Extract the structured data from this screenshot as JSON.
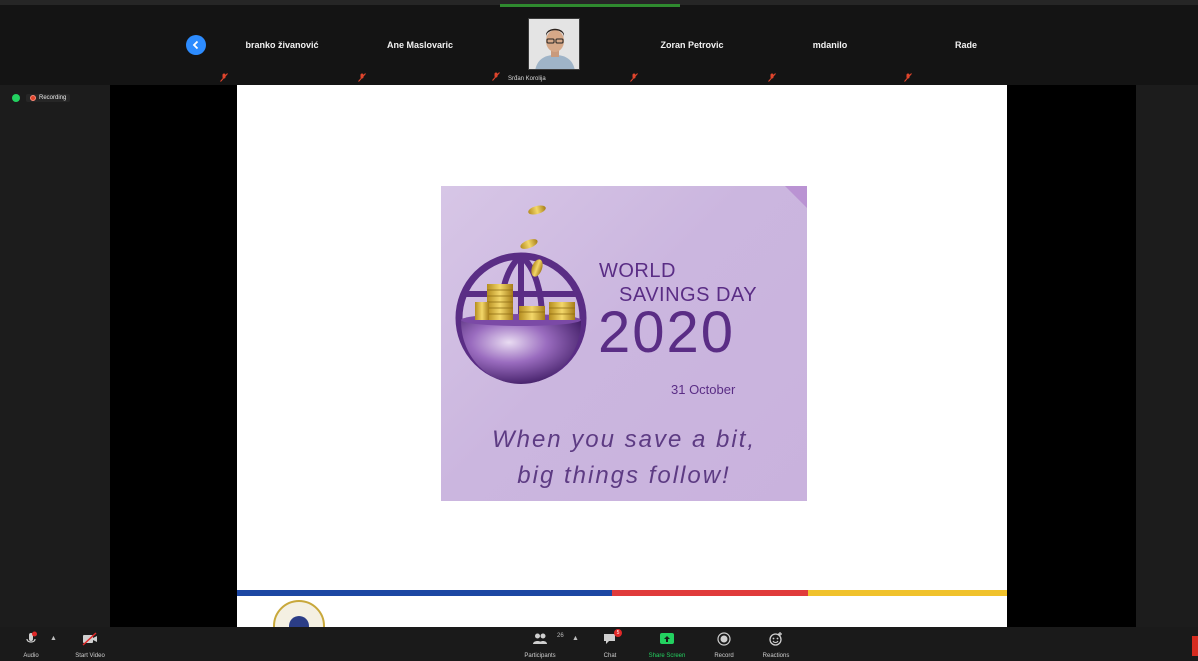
{
  "participants": [
    {
      "name": "branko živanović"
    },
    {
      "name": "Ane Maslovaric"
    },
    {
      "name": "Srđan Korolija",
      "has_video": true
    },
    {
      "name": "Zoran Petrovic"
    },
    {
      "name": "mdanilo"
    },
    {
      "name": "Rade"
    }
  ],
  "recording": {
    "label": "Recording"
  },
  "slide": {
    "poster": {
      "line1": "WORLD",
      "line2": "SAVINGS DAY",
      "year": "2020",
      "date": "31 October",
      "slogan1": "When you save a bit,",
      "slogan2": "big things follow!"
    },
    "stripe_colors": [
      "#1d47a3",
      "#e03b3b",
      "#f0c22c"
    ]
  },
  "toolbar": {
    "audio": "Audio",
    "start_video": "Start Video",
    "participants": "Participants",
    "participants_count": "26",
    "chat": "Chat",
    "chat_badge": "5",
    "share_screen": "Share Screen",
    "record": "Record",
    "reactions": "Reactions"
  },
  "colors": {
    "accent": "#2d8cff",
    "share_green": "#23d160",
    "poster_purple": "#5a2d85"
  }
}
